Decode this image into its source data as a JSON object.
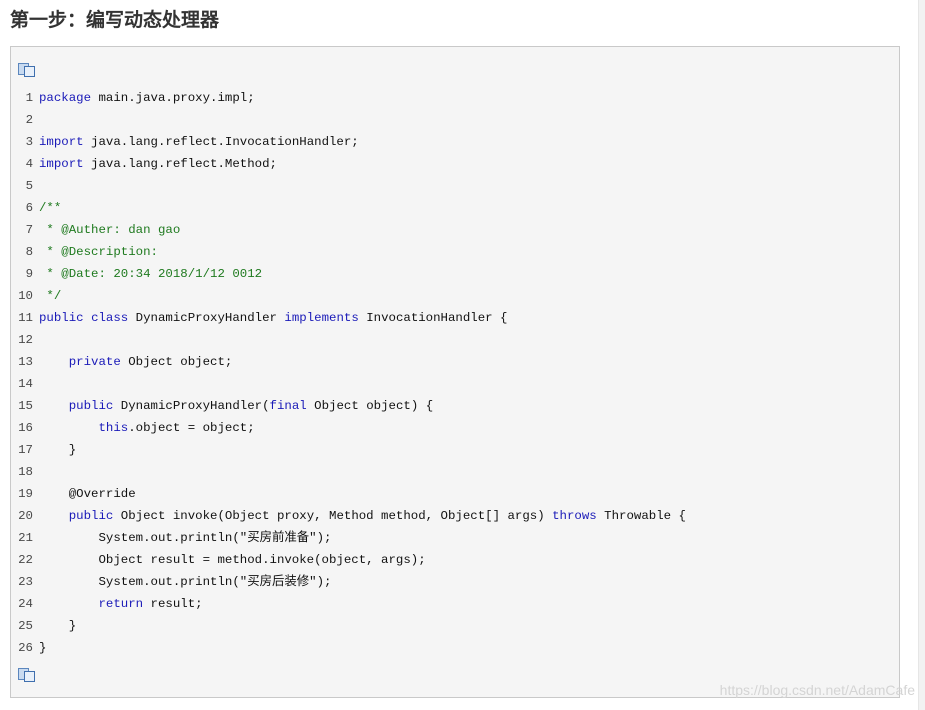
{
  "heading": "第一步：编写动态处理器",
  "code_block": {
    "copy_icon_top": "copy-icon",
    "copy_icon_bottom": "copy-icon",
    "lines": [
      {
        "n": "1",
        "tokens": [
          {
            "t": "package",
            "c": "kw"
          },
          {
            "t": " main.java.proxy.impl;",
            "c": ""
          }
        ]
      },
      {
        "n": "2",
        "tokens": []
      },
      {
        "n": "3",
        "tokens": [
          {
            "t": "import",
            "c": "kw"
          },
          {
            "t": " java.lang.reflect.InvocationHandler;",
            "c": ""
          }
        ]
      },
      {
        "n": "4",
        "tokens": [
          {
            "t": "import",
            "c": "kw"
          },
          {
            "t": " java.lang.reflect.Method;",
            "c": ""
          }
        ]
      },
      {
        "n": "5",
        "tokens": []
      },
      {
        "n": "6",
        "tokens": [
          {
            "t": "/**",
            "c": "cm"
          }
        ]
      },
      {
        "n": "7",
        "tokens": [
          {
            "t": " * @Auther: dan gao",
            "c": "cm"
          }
        ]
      },
      {
        "n": "8",
        "tokens": [
          {
            "t": " * @Description:",
            "c": "cm"
          }
        ]
      },
      {
        "n": "9",
        "tokens": [
          {
            "t": " * @Date: 20:34 2018/1/12 0012",
            "c": "cm"
          }
        ]
      },
      {
        "n": "10",
        "tokens": [
          {
            "t": " */",
            "c": "cm"
          }
        ]
      },
      {
        "n": "11",
        "tokens": [
          {
            "t": "public",
            "c": "kw"
          },
          {
            "t": " ",
            "c": ""
          },
          {
            "t": "class",
            "c": "kw"
          },
          {
            "t": " DynamicProxyHandler ",
            "c": ""
          },
          {
            "t": "implements",
            "c": "kw"
          },
          {
            "t": " InvocationHandler {",
            "c": ""
          }
        ]
      },
      {
        "n": "12",
        "tokens": []
      },
      {
        "n": "13",
        "tokens": [
          {
            "t": "    ",
            "c": ""
          },
          {
            "t": "private",
            "c": "kw"
          },
          {
            "t": " Object object;",
            "c": ""
          }
        ]
      },
      {
        "n": "14",
        "tokens": []
      },
      {
        "n": "15",
        "tokens": [
          {
            "t": "    ",
            "c": ""
          },
          {
            "t": "public",
            "c": "kw"
          },
          {
            "t": " DynamicProxyHandler(",
            "c": ""
          },
          {
            "t": "final",
            "c": "kw"
          },
          {
            "t": " Object object) {",
            "c": ""
          }
        ]
      },
      {
        "n": "16",
        "tokens": [
          {
            "t": "        ",
            "c": ""
          },
          {
            "t": "this",
            "c": "kw"
          },
          {
            "t": ".object = object;",
            "c": ""
          }
        ]
      },
      {
        "n": "17",
        "tokens": [
          {
            "t": "    }",
            "c": ""
          }
        ]
      },
      {
        "n": "18",
        "tokens": []
      },
      {
        "n": "19",
        "tokens": [
          {
            "t": "    @Override",
            "c": ""
          }
        ]
      },
      {
        "n": "20",
        "tokens": [
          {
            "t": "    ",
            "c": ""
          },
          {
            "t": "public",
            "c": "kw"
          },
          {
            "t": " Object invoke(Object proxy, Method method, Object[] args) ",
            "c": ""
          },
          {
            "t": "throws",
            "c": "kw"
          },
          {
            "t": " Throwable {",
            "c": ""
          }
        ]
      },
      {
        "n": "21",
        "tokens": [
          {
            "t": "        System.out.println(\"买房前准备\");",
            "c": ""
          }
        ]
      },
      {
        "n": "22",
        "tokens": [
          {
            "t": "        Object result = method.invoke(object, args);",
            "c": ""
          }
        ]
      },
      {
        "n": "23",
        "tokens": [
          {
            "t": "        System.out.println(\"买房后装修\");",
            "c": ""
          }
        ]
      },
      {
        "n": "24",
        "tokens": [
          {
            "t": "        ",
            "c": ""
          },
          {
            "t": "return",
            "c": "kw"
          },
          {
            "t": " result;",
            "c": ""
          }
        ]
      },
      {
        "n": "25",
        "tokens": [
          {
            "t": "    }",
            "c": ""
          }
        ]
      },
      {
        "n": "26",
        "tokens": [
          {
            "t": "}",
            "c": ""
          }
        ]
      }
    ]
  },
  "watermark": "https://blog.csdn.net/AdamCafe",
  "colors": {
    "keyword": "#1a1ab8",
    "comment": "#1f7a1f",
    "code_background": "#f5f5f5"
  }
}
